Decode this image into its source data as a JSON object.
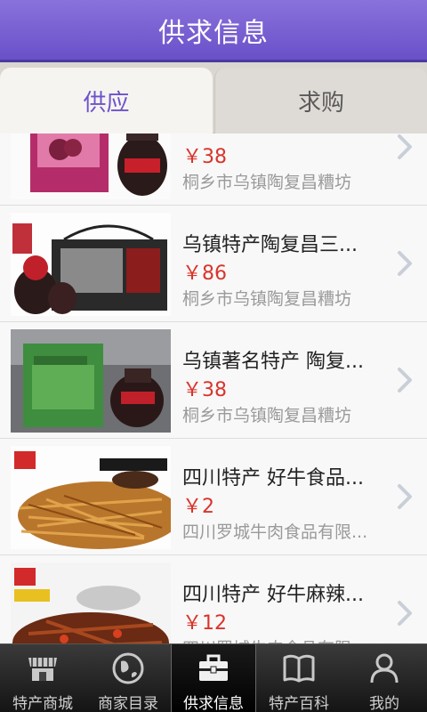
{
  "title": "供求信息",
  "tabs": {
    "supply": "供应",
    "demand": "求购"
  },
  "items": [
    {
      "name": "",
      "price": "￥38",
      "company": "桐乡市乌镇陶复昌糟坊"
    },
    {
      "name": "乌镇特产陶复昌三...",
      "price": "￥86",
      "company": "桐乡市乌镇陶复昌糟坊"
    },
    {
      "name": "乌镇著名特产 陶复...",
      "price": "￥38",
      "company": "桐乡市乌镇陶复昌糟坊"
    },
    {
      "name": "四川特产 好牛食品...",
      "price": "￥2",
      "company": "四川罗城牛肉食品有限..."
    },
    {
      "name": "四川特产 好牛麻辣...",
      "price": "￥12",
      "company": "四川罗城牛肉食品有限..."
    }
  ],
  "nav": [
    {
      "label": "特产商城",
      "icon": "storefront-icon"
    },
    {
      "label": "商家目录",
      "icon": "globe-icon"
    },
    {
      "label": "供求信息",
      "icon": "briefcase-icon"
    },
    {
      "label": "特产百科",
      "icon": "book-icon"
    },
    {
      "label": "我的",
      "icon": "user-icon"
    }
  ],
  "colors": {
    "accent": "#6b53cc",
    "price": "#d9342b",
    "header": "#7a62d4"
  }
}
